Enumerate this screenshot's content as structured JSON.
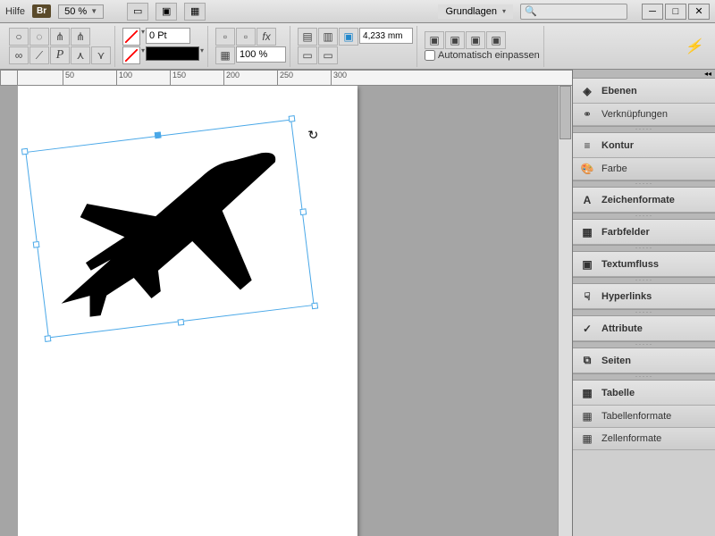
{
  "menubar": {
    "help": "Hilfe",
    "bridge": "Br",
    "zoom": "50 %",
    "workspace": "Grundlagen"
  },
  "toolbar": {
    "stroke_pt": "0 Pt",
    "opacity": "100 %",
    "measure": "4,233 mm",
    "autofit": "Automatisch einpassen"
  },
  "ruler": {
    "t50": "50",
    "t100": "100",
    "t150": "150",
    "t200": "200",
    "t250": "250",
    "t300": "300"
  },
  "panels": {
    "ebenen": "Ebenen",
    "verknupfungen": "Verknüpfungen",
    "kontur": "Kontur",
    "farbe": "Farbe",
    "zeichenformate": "Zeichenformate",
    "farbfelder": "Farbfelder",
    "textumfluss": "Textumfluss",
    "hyperlinks": "Hyperlinks",
    "attribute": "Attribute",
    "seiten": "Seiten",
    "tabelle": "Tabelle",
    "tabellenformate": "Tabellenformate",
    "zellenformate": "Zellenformate"
  }
}
